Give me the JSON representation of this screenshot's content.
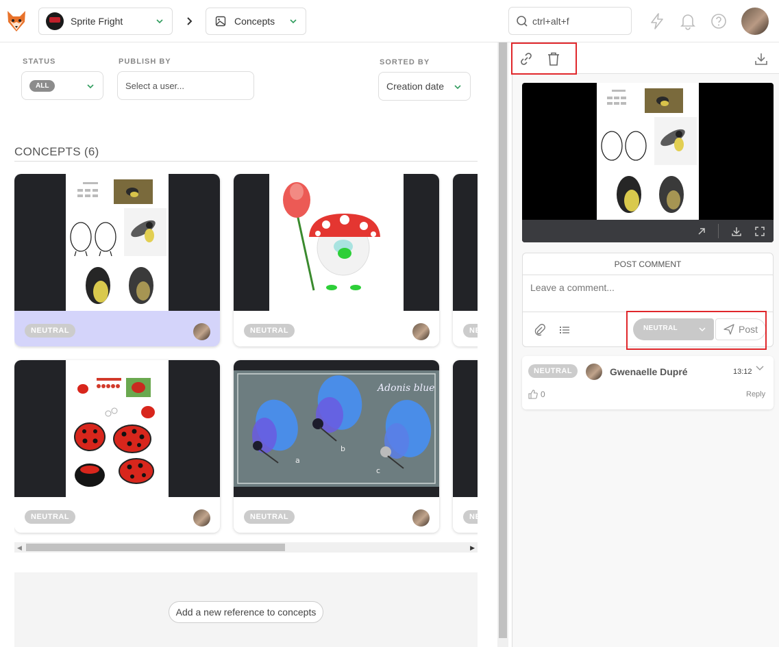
{
  "header": {
    "project": "Sprite Fright",
    "section": "Concepts",
    "search_placeholder": "ctrl+alt+f"
  },
  "filters": {
    "status_label": "STATUS",
    "status_value": "ALL",
    "publish_label": "PUBLISH BY",
    "publish_placeholder": "Select a user...",
    "sorted_label": "SORTED BY",
    "sorted_value": "Creation date"
  },
  "concepts": {
    "title": "CONCEPTS (6)",
    "items": [
      {
        "status": "NEUTRAL",
        "subject": "tits"
      },
      {
        "status": "NEUTRAL",
        "subject": "mushroom"
      },
      {
        "status": "NE"
      },
      {
        "status": "NEUTRAL",
        "subject": "ladybugs"
      },
      {
        "status": "NEUTRAL",
        "subject": "butterflies",
        "caption": "Adonis blue",
        "labels": [
          "a",
          "b",
          "c"
        ]
      },
      {
        "status": "NE"
      }
    ],
    "add_reference": "Add a new reference to concepts"
  },
  "panel": {
    "post_comment_title": "POST COMMENT",
    "comment_placeholder": "Leave a comment...",
    "status_option": "NEUTRAL",
    "post_label": "Post",
    "comment": {
      "status": "NEUTRAL",
      "author": "Gwenaelle Dupré",
      "time": "13:12",
      "likes": "0",
      "reply": "Reply"
    }
  },
  "colors": {
    "selected_card": "#d4d4fa",
    "highlight_box": "#e0262a",
    "status_grey": "#cccccc"
  }
}
